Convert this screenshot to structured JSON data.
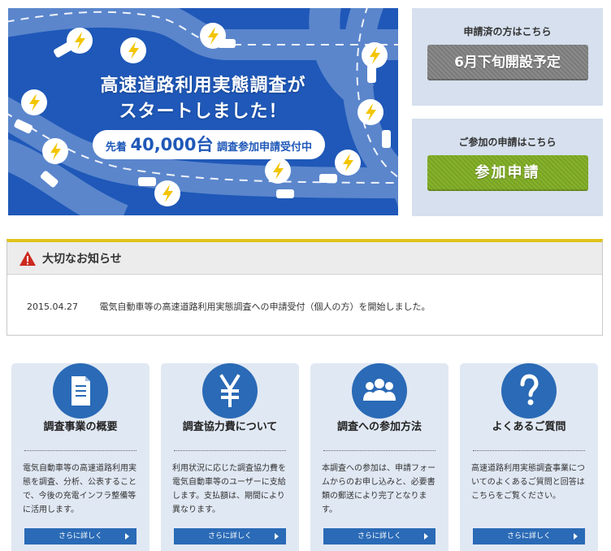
{
  "hero": {
    "headline_line1": "高速道路利用実態調査が",
    "headline_line2": "スタートしました！",
    "pill_prefix": "先着",
    "pill_count": "40,000台",
    "pill_suffix": "調査参加申請受付中"
  },
  "side": {
    "applied_caption": "申請済の方はこちら",
    "applied_button": "6月下旬開設予定",
    "apply_caption": "ご参加の申請はこちら",
    "apply_button": "参加申請"
  },
  "notice": {
    "title": "大切なお知らせ",
    "items": [
      {
        "date": "2015.04.27",
        "text": "電気自動車等の高速道路利用実態調査への申請受付（個人の方）を開始しました。"
      }
    ]
  },
  "cards": [
    {
      "icon": "document-icon",
      "title": "調査事業の概要",
      "desc": "電気自動車等の高速道路利用実態を調査、分析、公表することで、今後の充電インフラ整備等に活用します。",
      "more": "さらに詳しく"
    },
    {
      "icon": "yen-icon",
      "title": "調査協力費について",
      "desc": "利用状況に応じた調査協力費を電気自動車等のユーザーに支給します。支払額は、期間により異なります。",
      "more": "さらに詳しく"
    },
    {
      "icon": "people-icon",
      "title": "調査への参加方法",
      "desc": "本調査への参加は、申請フォームからのお申し込みと、必要書類の郵送により完了となります。",
      "more": "さらに詳しく"
    },
    {
      "icon": "question-icon",
      "title": "よくあるご質問",
      "desc": "高速道路利用実態調査事業についてのよくあるご質問と回答はこちらをご覧ください。",
      "more": "さらに詳しく"
    }
  ],
  "colors": {
    "hero_blue": "#1f58b8",
    "accent_blue": "#2a6ab6",
    "apply_green": "#86b12c",
    "notice_yellow": "#e0c31c",
    "bolt_yellow": "#f3c500"
  }
}
